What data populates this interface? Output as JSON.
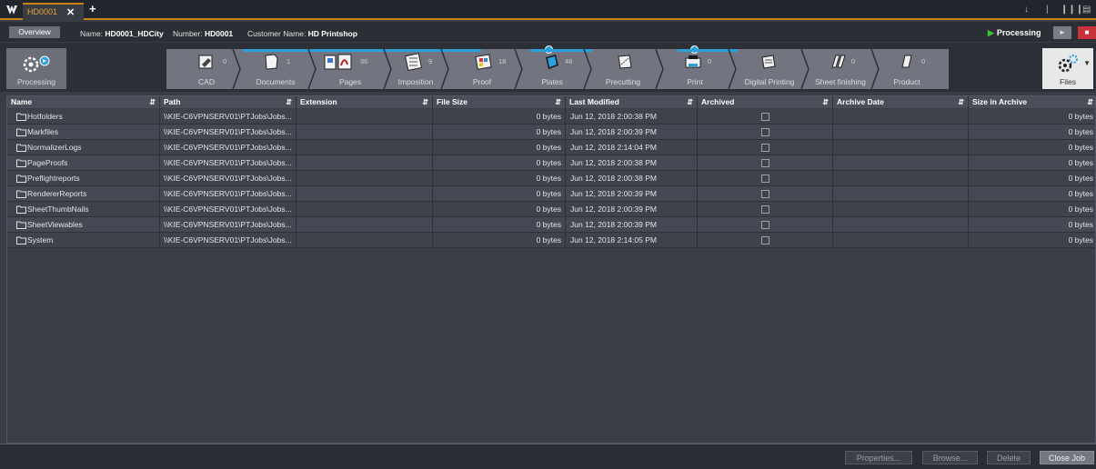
{
  "tab": {
    "label": "HD0001",
    "close": "✕",
    "add": "+"
  },
  "info": {
    "overview_label": "Overview",
    "name_label": "Name:",
    "name_value": "HD0001_HDCity",
    "number_label": "Number:",
    "number_value": "HD0001",
    "customer_label": "Customer Name:",
    "customer_value": "HD Printshop",
    "status": "Processing"
  },
  "workflow": {
    "left_tile": {
      "label": "Processing",
      "icon": "processing-gear-icon"
    },
    "right_tile": {
      "label": "Files",
      "icon": "files-gear-icon"
    },
    "stages": [
      {
        "label": "CAD",
        "count": "0"
      },
      {
        "label": "Documents",
        "count": "1"
      },
      {
        "label": "Pages",
        "count": "36"
      },
      {
        "label": "Imposition",
        "count": "9"
      },
      {
        "label": "Proof",
        "count": "18"
      },
      {
        "label": "Plates",
        "count": "48"
      },
      {
        "label": "Precutting",
        "count": ""
      },
      {
        "label": "Print",
        "count": "0"
      },
      {
        "label": "Digital Printing",
        "count": ""
      },
      {
        "label": "Sheet finishing",
        "count": "0"
      },
      {
        "label": "Product",
        "count": "0"
      }
    ]
  },
  "table": {
    "columns": [
      "Name",
      "Path",
      "Extension",
      "File Size",
      "Last Modified",
      "Archived",
      "Archive Date",
      "Size in Archive"
    ],
    "rows": [
      {
        "name": "Hotfolders",
        "path": "\\\\KIE-C6VPNSERV01\\PTJobs\\Jobs...",
        "extension": "",
        "size": "0 bytes",
        "modified": "Jun 12, 2018 2:00:38 PM",
        "archived": false,
        "archive_date": "",
        "size_archive": "0 bytes"
      },
      {
        "name": "Markfiles",
        "path": "\\\\KIE-C6VPNSERV01\\PTJobs\\Jobs...",
        "extension": "",
        "size": "0 bytes",
        "modified": "Jun 12, 2018 2:00:39 PM",
        "archived": false,
        "archive_date": "",
        "size_archive": "0 bytes"
      },
      {
        "name": "NormalizerLogs",
        "path": "\\\\KIE-C6VPNSERV01\\PTJobs\\Jobs...",
        "extension": "",
        "size": "0 bytes",
        "modified": "Jun 12, 2018 2:14:04 PM",
        "archived": false,
        "archive_date": "",
        "size_archive": "0 bytes"
      },
      {
        "name": "PageProofs",
        "path": "\\\\KIE-C6VPNSERV01\\PTJobs\\Jobs...",
        "extension": "",
        "size": "0 bytes",
        "modified": "Jun 12, 2018 2:00:38 PM",
        "archived": false,
        "archive_date": "",
        "size_archive": "0 bytes"
      },
      {
        "name": "Preflightreports",
        "path": "\\\\KIE-C6VPNSERV01\\PTJobs\\Jobs...",
        "extension": "",
        "size": "0 bytes",
        "modified": "Jun 12, 2018 2:00:38 PM",
        "archived": false,
        "archive_date": "",
        "size_archive": "0 bytes"
      },
      {
        "name": "RendererReports",
        "path": "\\\\KIE-C6VPNSERV01\\PTJobs\\Jobs...",
        "extension": "",
        "size": "0 bytes",
        "modified": "Jun 12, 2018 2:00:39 PM",
        "archived": false,
        "archive_date": "",
        "size_archive": "0 bytes"
      },
      {
        "name": "SheetThumbNails",
        "path": "\\\\KIE-C6VPNSERV01\\PTJobs\\Jobs...",
        "extension": "",
        "size": "0 bytes",
        "modified": "Jun 12, 2018 2:00:39 PM",
        "archived": false,
        "archive_date": "",
        "size_archive": "0 bytes"
      },
      {
        "name": "SheetViewables",
        "path": "\\\\KIE-C6VPNSERV01\\PTJobs\\Jobs...",
        "extension": "",
        "size": "0 bytes",
        "modified": "Jun 12, 2018 2:00:39 PM",
        "archived": false,
        "archive_date": "",
        "size_archive": "0 bytes"
      },
      {
        "name": "System",
        "path": "\\\\KIE-C6VPNSERV01\\PTJobs\\Jobs...",
        "extension": "",
        "size": "0 bytes",
        "modified": "Jun 12, 2018 2:14:05 PM",
        "archived": false,
        "archive_date": "",
        "size_archive": "0 bytes"
      }
    ]
  },
  "footer": {
    "properties": "Properties...",
    "browse": "Browse...",
    "delete": "Delete",
    "close_job": "Close Job"
  },
  "colors": {
    "accent": "#c9820e",
    "progress": "#2aa0dc",
    "running": "#3cc43c",
    "stop": "#c8343a"
  }
}
